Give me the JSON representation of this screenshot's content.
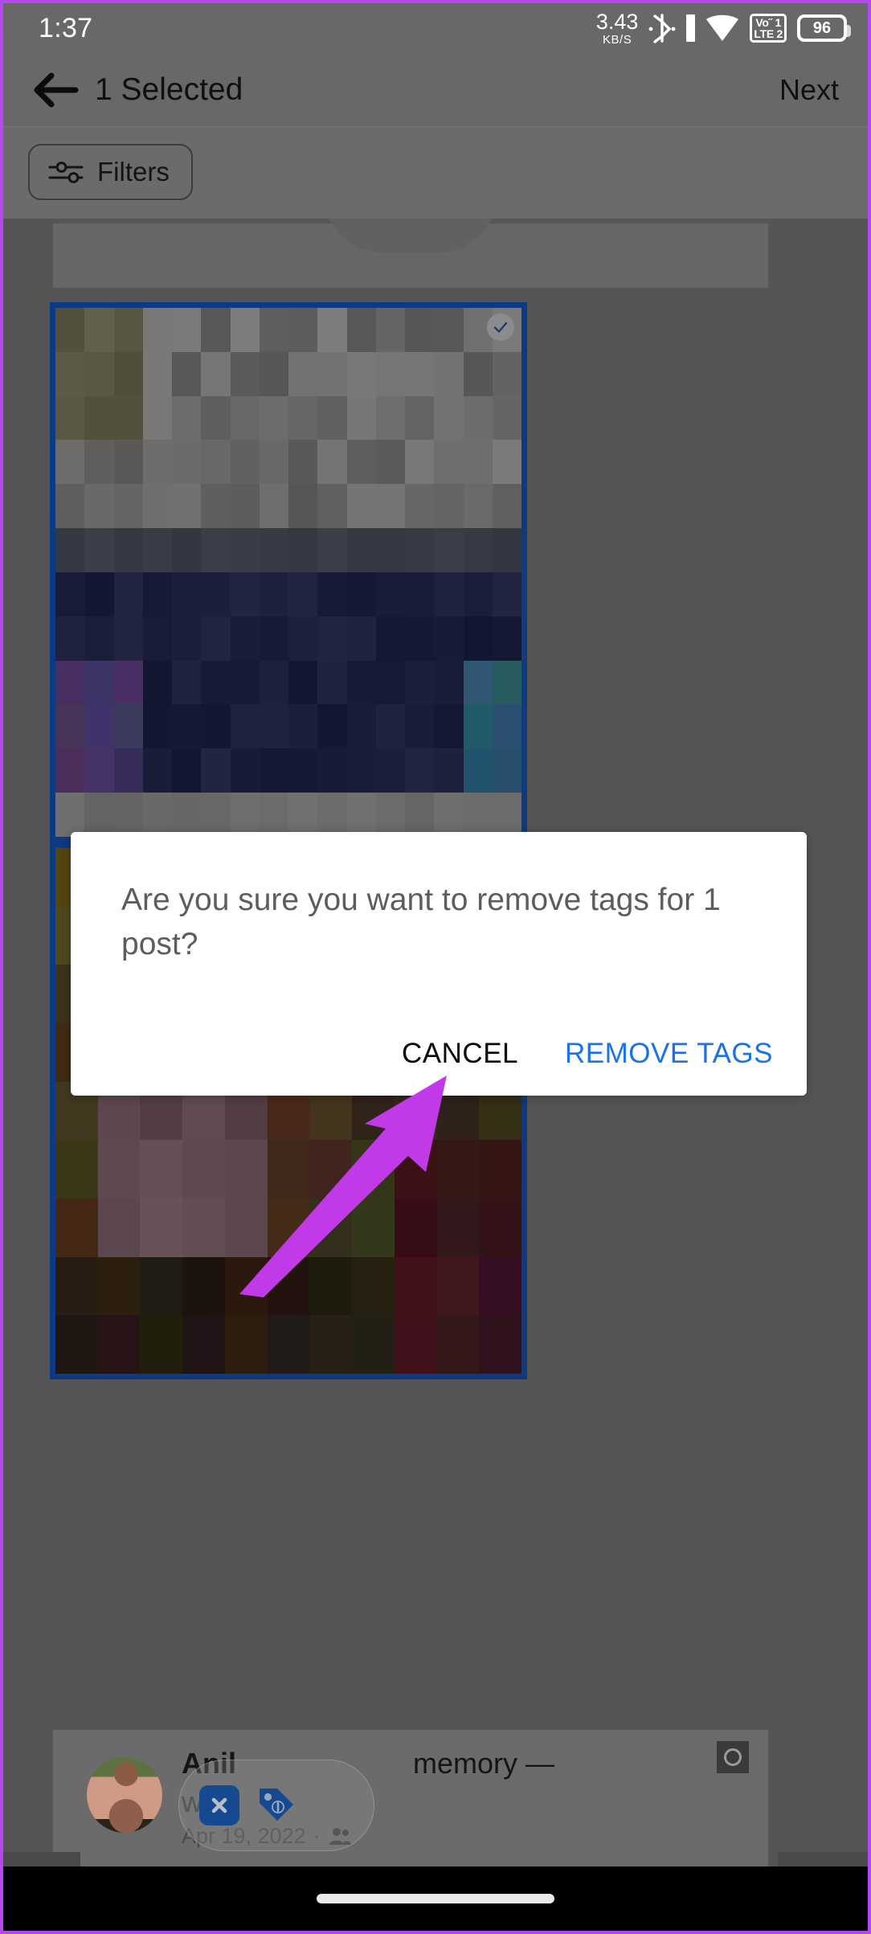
{
  "status_bar": {
    "clock": "1:37",
    "data_speed_value": "3.43",
    "data_speed_unit": "KB/S",
    "bluetooth_icon": "bluetooth-icon",
    "signal_icon": "signal-bar-icon",
    "wifi_icon": "wifi-icon",
    "volte_line1": "Vo˝ 1",
    "volte_line2": "LTE 2",
    "battery_level": "96"
  },
  "header": {
    "back_icon": "back-arrow-icon",
    "title": "1 Selected",
    "next_label": "Next"
  },
  "filter_bar": {
    "filters_label": "Filters",
    "filters_icon": "tune-sliders-icon"
  },
  "post_card": {
    "selected": true,
    "check_icon": "check-circle-icon",
    "border_color": "#0d3a84"
  },
  "bottom_post": {
    "avatar_icon": "avatar",
    "author": "Anil",
    "line1_suffix": "memory —",
    "line2": "with",
    "date": "Apr 19, 2022",
    "audience_separator": "·",
    "audience_icon": "friends-icon",
    "radio_icon": "radio-unchecked-icon"
  },
  "action_pill": {
    "close_icon": "close-x-icon",
    "tag_icon": "tag-icon",
    "delete_icon": "trash-icon",
    "accent_color": "#164a90"
  },
  "dialog": {
    "message": "Are you sure you want to remove tags for 1 post?",
    "cancel_label": "CANCEL",
    "confirm_label": "REMOVE TAGS",
    "confirm_color": "#1a73e8"
  },
  "annotation": {
    "arrow_icon": "pointer-arrow-icon",
    "arrow_color": "#c03ae8"
  },
  "nav_bar": {
    "home_indicator": "home-pill-indicator"
  },
  "theme": {
    "frame_border": "#b44aed",
    "chrome_bg": "#686868",
    "content_dim": "#555555"
  }
}
